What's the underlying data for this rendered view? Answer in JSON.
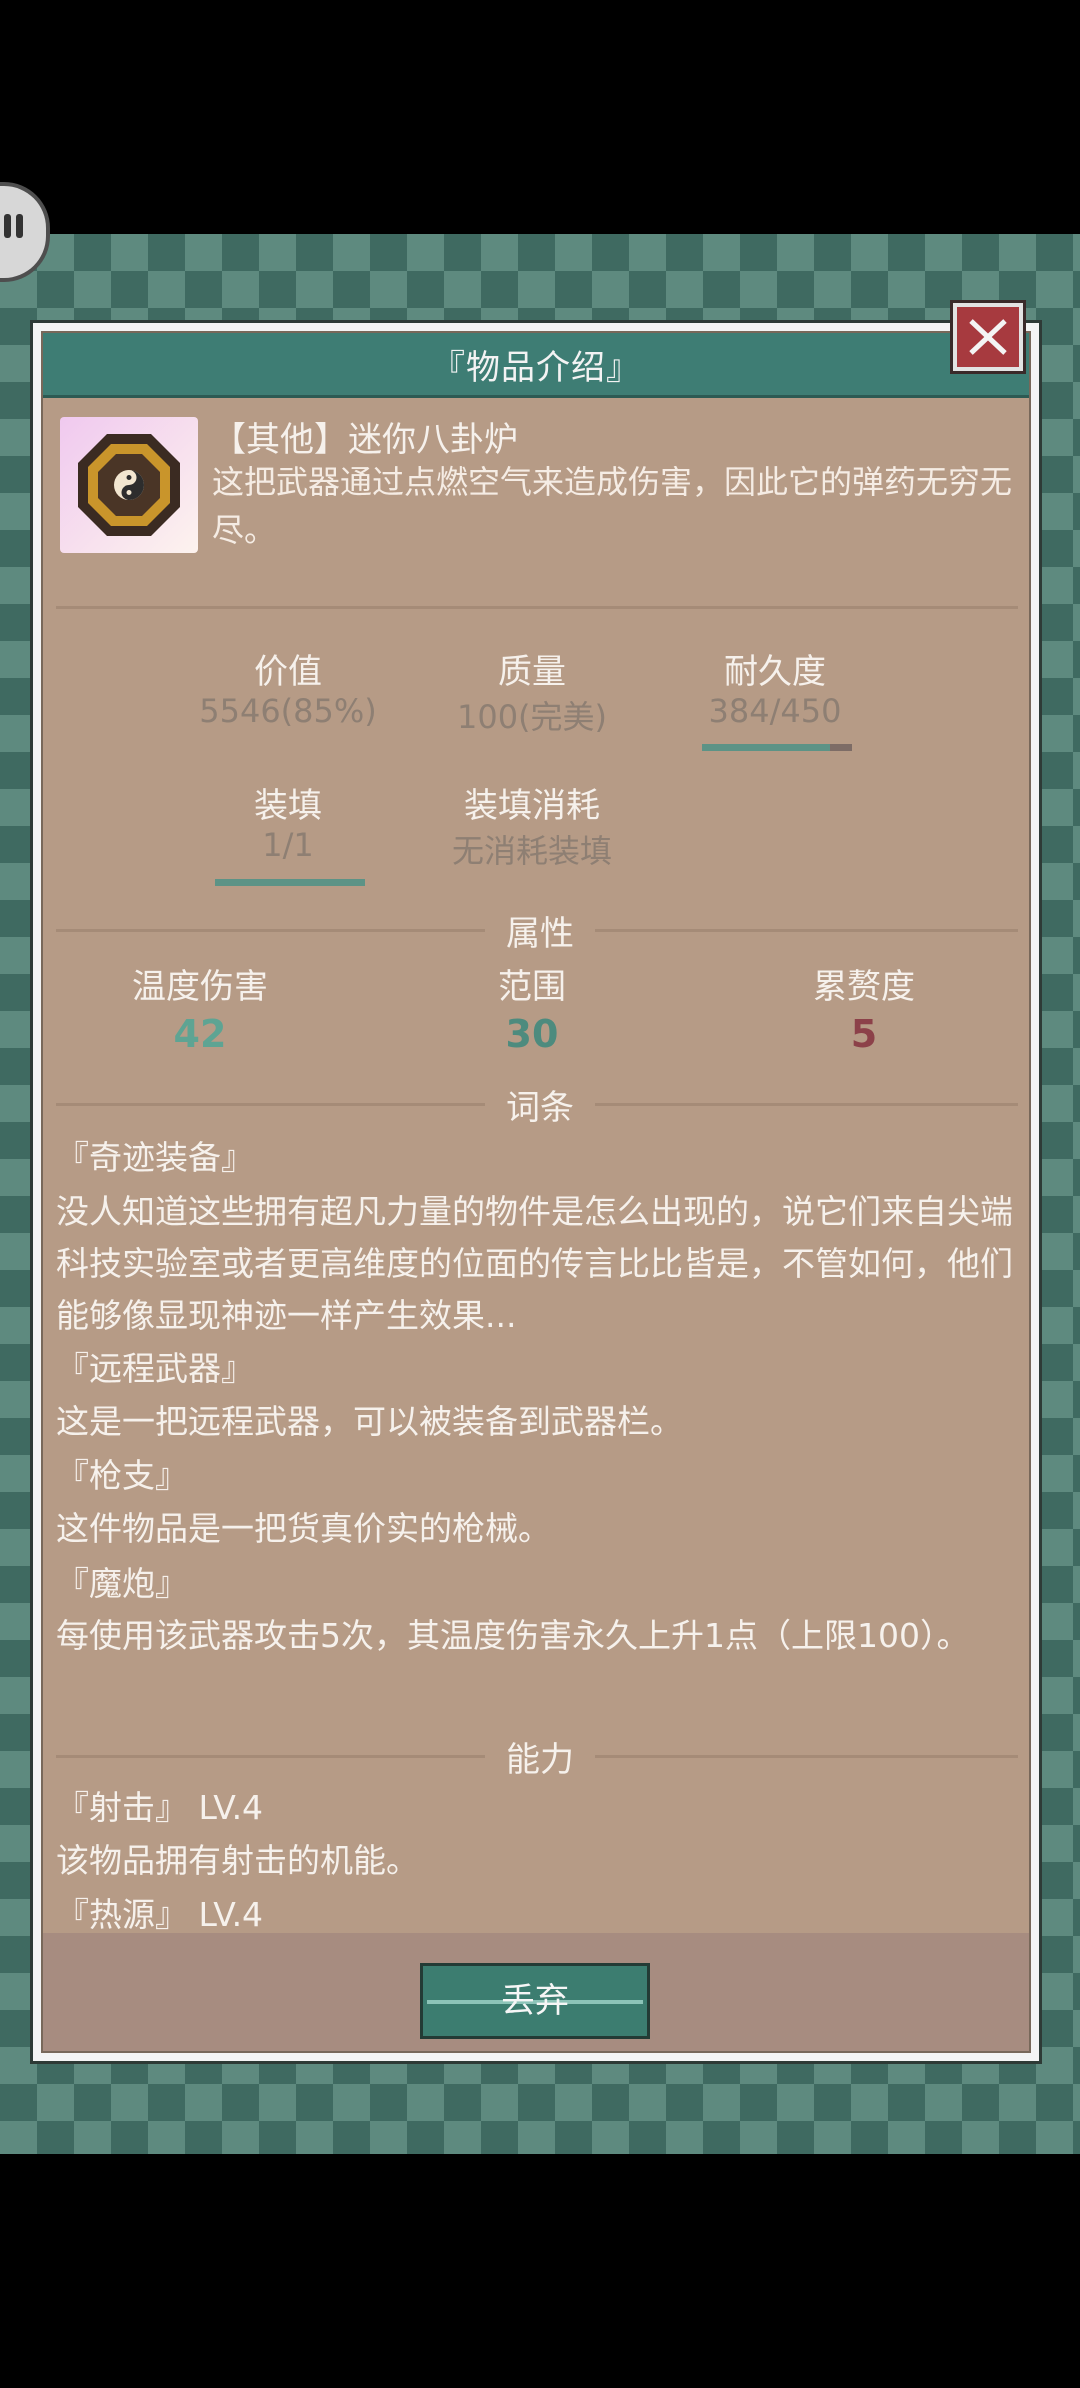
{
  "panel": {
    "title": "『物品介绍』"
  },
  "item": {
    "name": "【其他】迷你八卦炉",
    "description": "这把武器通过点燃空气来造成伤害，因此它的弹药无穷无尽。",
    "icon": "bagua-icon"
  },
  "stats": {
    "value_label": "价值",
    "value": "5546(85%)",
    "quality_label": "质量",
    "quality": "100(完美)",
    "durability_label": "耐久度",
    "durability": "384/450",
    "durability_fraction": 0.853,
    "load_label": "装填",
    "load": "1/1",
    "load_fraction": 1.0,
    "load_cost_label": "装填消耗",
    "load_cost": "无消耗装填"
  },
  "attributes": {
    "heading": "属性",
    "items": [
      {
        "label": "温度伤害",
        "value": "42",
        "color": "#5ea493"
      },
      {
        "label": "范围",
        "value": "30",
        "color": "#4d8b7e"
      },
      {
        "label": "累赘度",
        "value": "5",
        "color": "#8c4149"
      }
    ]
  },
  "entries": {
    "heading": "词条",
    "list": [
      {
        "title": "『奇迹装备』",
        "text": "没人知道这些拥有超凡力量的物件是怎么出现的，说它们来自尖端科技实验室或者更高维度的位面的传言比比皆是，不管如何，他们能够像显现神迹一样产生效果..."
      },
      {
        "title": "『远程武器』",
        "text": "这是一把远程武器，可以被装备到武器栏。"
      },
      {
        "title": "『枪支』",
        "text": "这件物品是一把货真价实的枪械。"
      },
      {
        "title": "『魔炮』",
        "text": "每使用该武器攻击5次，其温度伤害永久上升1点（上限100）。"
      }
    ]
  },
  "abilities": {
    "heading": "能力",
    "list": [
      {
        "title": "『射击』 LV.4",
        "text": "该物品拥有射击的机能。"
      },
      {
        "title": "『热源』 LV.4",
        "text": ""
      }
    ]
  },
  "footer": {
    "discard_label": "丢弃"
  },
  "colors": {
    "title_bar": "#3e7d74",
    "panel_bg": "#b69b86",
    "close": "#a73a3f"
  }
}
